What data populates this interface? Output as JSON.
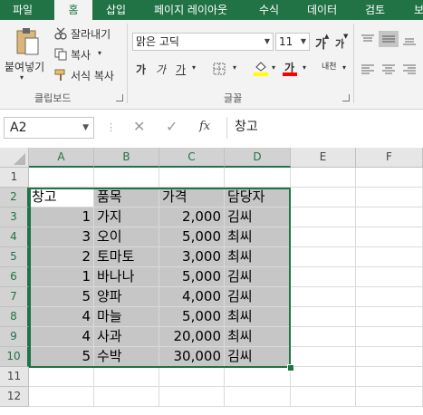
{
  "tabs": [
    "파일",
    "홈",
    "삽입",
    "페이지 레이아웃",
    "수식",
    "데이터",
    "검토",
    "보"
  ],
  "active_tab": "홈",
  "ribbon": {
    "clipboard": {
      "paste_label": "붙여넣기",
      "cut_label": "잘라내기",
      "copy_label": "복사",
      "format_painter_label": "서식 복사",
      "group_label": "클립보드"
    },
    "font": {
      "font_name": "맑은 고딕",
      "font_size": "11",
      "grow_label": "가",
      "shrink_label": "가",
      "bold_label": "가",
      "italic_label": "가",
      "underline_label": "가",
      "font_color_label": "가",
      "phonetic_label": "내천",
      "group_label": "글꼴"
    },
    "colors": {
      "accent": "#217346",
      "fill_yellow": "#ffff00",
      "font_red": "#ff0000"
    }
  },
  "formula_bar": {
    "name_box": "A2",
    "fx_label": "fx",
    "formula": "창고"
  },
  "sheet": {
    "columns": [
      "A",
      "B",
      "C",
      "D",
      "E",
      "F"
    ],
    "rows": [
      "1",
      "2",
      "3",
      "4",
      "5",
      "6",
      "7",
      "8",
      "9",
      "10",
      "11",
      "12"
    ],
    "header": [
      "창고",
      "품목",
      "가격",
      "담당자"
    ],
    "data": [
      [
        "1",
        "가지",
        "2,000",
        "김씨"
      ],
      [
        "3",
        "오이",
        "5,000",
        "최씨"
      ],
      [
        "2",
        "토마토",
        "3,000",
        "최씨"
      ],
      [
        "1",
        "바나나",
        "5,000",
        "김씨"
      ],
      [
        "5",
        "양파",
        "4,000",
        "김씨"
      ],
      [
        "4",
        "마늘",
        "5,000",
        "최씨"
      ],
      [
        "4",
        "사과",
        "20,000",
        "최씨"
      ],
      [
        "5",
        "수박",
        "30,000",
        "김씨"
      ]
    ]
  }
}
